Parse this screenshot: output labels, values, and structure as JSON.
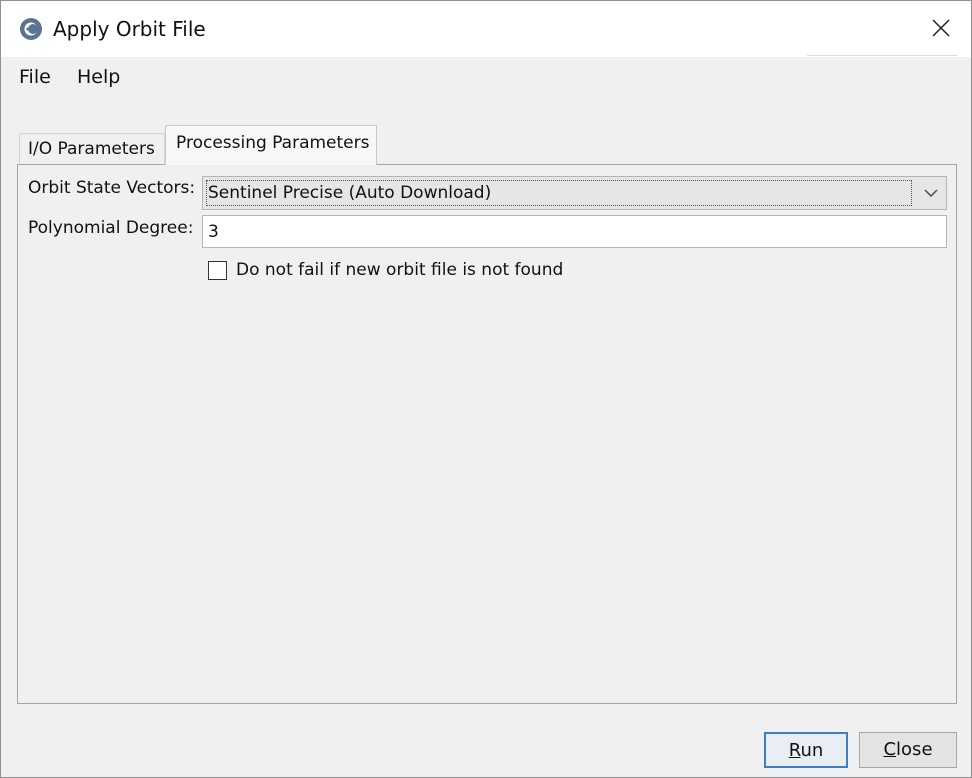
{
  "window": {
    "title": "Apply Orbit File",
    "app_icon": "satellite-globe-icon",
    "close_icon": "close-icon"
  },
  "menu": {
    "items": [
      {
        "label": "File"
      },
      {
        "label": "Help"
      }
    ]
  },
  "tabs": [
    {
      "label": "I/O Parameters",
      "selected": false
    },
    {
      "label": "Processing Parameters",
      "selected": true
    }
  ],
  "form": {
    "orbit_state_vectors": {
      "label": "Orbit State Vectors:",
      "value": "Sentinel Precise (Auto Download)",
      "dropdown_icon": "chevron-down-icon"
    },
    "polynomial_degree": {
      "label": "Polynomial Degree:",
      "value": "3"
    },
    "continue_on_fail": {
      "label": "Do not fail if new orbit file is not found",
      "checked": false
    }
  },
  "buttons": {
    "run": {
      "mnemonic": "R",
      "rest": "un"
    },
    "close": {
      "mnemonic": "C",
      "rest": "lose"
    }
  },
  "colors": {
    "accent_focus": "#3d7fc4",
    "window_bg": "#f0f0f0",
    "titlebar_bg": "#ffffff"
  }
}
